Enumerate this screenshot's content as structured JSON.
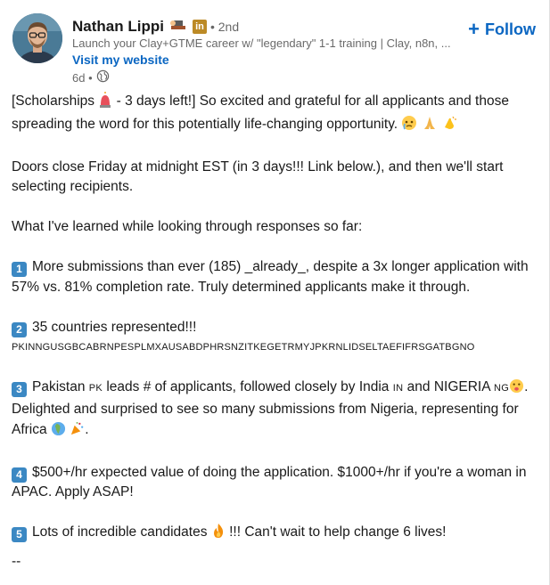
{
  "author": {
    "name": "Nathan Lippi",
    "badge_in": "in",
    "degree": "• 2nd",
    "tagline": "Launch your Clay+GTME career w/ \"legendary\" 1-1 training | Clay, n8n, ...",
    "website_label": "Visit my website",
    "time": "6d •",
    "icons": [
      "working-emoji",
      "linkedin-premium-badge",
      "globe-icon"
    ]
  },
  "follow": {
    "plus": "+",
    "label": "Follow"
  },
  "post": {
    "p1a": "[Scholarships ",
    "p1b": " - 3 days left!] So excited and grateful for all applicants and those spreading the word for this potentially life-changing opportunity. ",
    "p2": "Doors close Friday at midnight EST (in 3 days!!! Link below.), and then we'll start selecting recipients.",
    "p3": "What I've learned while looking through responses so far:",
    "k1": "1",
    "p4": "More submissions than ever (185) _already_, despite a 3x longer application with 57% vs. 81% completion rate. Truly determined applicants make it through.",
    "k2": "2",
    "p5": "35 countries represented!!!",
    "p5_codes": "PKINNGUSGBCABRNPESPLMXAUSABDPHRSNZITKEGETRMYJPKRNLIDSELTAEFIFRSGATBGNO",
    "k3": "3",
    "p6a": "Pakistan ",
    "p6_pk": "PK",
    "p6b": " leads # of applicants, followed closely by India ",
    "p6_in": "IN",
    "p6c": " and NIGERIA ",
    "p6_ng": "NG",
    "p6d": ". Delighted and surprised to see so many submissions from Nigeria, representing for Africa ",
    "p6e": ".",
    "k4": "4",
    "p7": "$500+/hr expected value of doing the application. $1000+/hr if you're a woman in APAC. Apply ASAP!",
    "k5": "5",
    "p8a": "Lots of incredible candidates ",
    "p8b": " !!! Can't wait to help change 6 lives!",
    "dashes": "--"
  },
  "colors": {
    "accent": "#0a66c2",
    "keycap": "#3b88c3",
    "premium": "#bc8a26"
  }
}
